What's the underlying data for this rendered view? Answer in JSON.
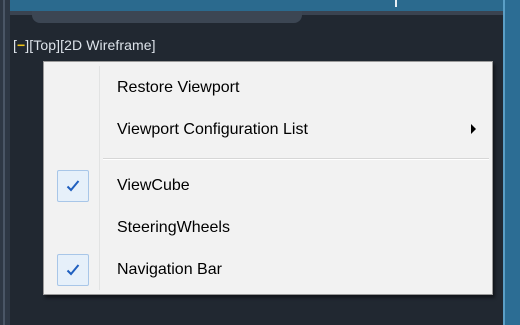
{
  "viewport_controls": {
    "minus": "−",
    "view": "[Top]",
    "visual_style": "[2D Wireframe]"
  },
  "menu": {
    "items": [
      {
        "label": "Restore Viewport",
        "checked": false,
        "submenu": false
      },
      {
        "label": "Viewport Configuration List",
        "checked": false,
        "submenu": true
      },
      {
        "label": "ViewCube",
        "checked": true,
        "submenu": false
      },
      {
        "label": "SteeringWheels",
        "checked": false,
        "submenu": false
      },
      {
        "label": "Navigation Bar",
        "checked": true,
        "submenu": false
      }
    ]
  },
  "colors": {
    "viewport_bg": "#212831",
    "menu_bg": "#f2f2f2",
    "check_blue": "#1f5fbf",
    "minus_yellow": "#f0c419"
  },
  "icons": {
    "check": "checkmark-icon",
    "submenu": "submenu-arrow-icon"
  }
}
